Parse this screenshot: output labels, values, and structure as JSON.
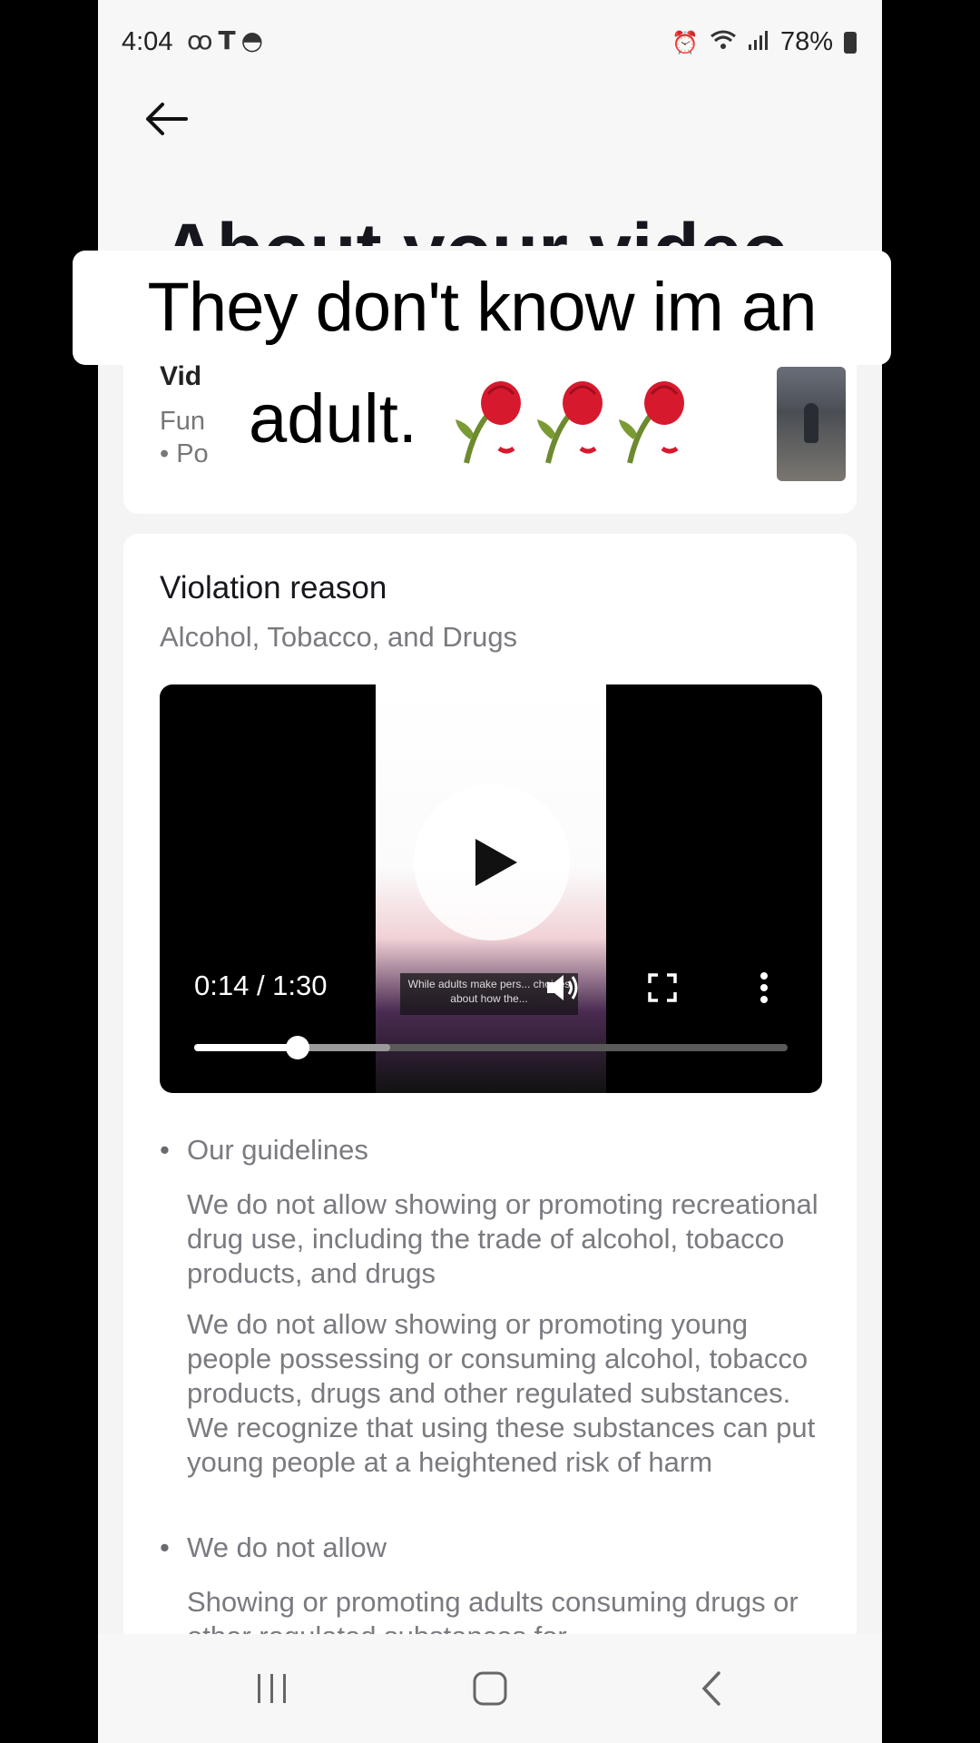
{
  "status_bar": {
    "time": "4:04",
    "battery": "78%",
    "left_icons": [
      "voicemail-icon",
      "t-mobile-icon",
      "incognito-icon"
    ],
    "right_icons": [
      "alarm-icon",
      "wifi-icon",
      "signal-icon",
      "battery-icon"
    ]
  },
  "header": {
    "title": "About your video"
  },
  "video_card": {
    "title_fragment": "Vid",
    "subtitle_fragment": "Fun",
    "bullet_fragment": "Po"
  },
  "violation": {
    "title": "Violation reason",
    "reason": "Alcohol, Tobacco, and Drugs"
  },
  "player": {
    "time_readout": "0:14 / 1:30",
    "caption": "While adults make pers... choices about how the...",
    "progress_fraction": 0.175,
    "buffer_fraction": 0.33
  },
  "guidelines": [
    {
      "heading": "Our guidelines",
      "paragraphs": [
        "We do not allow showing or promoting recreational drug use, including the trade of alcohol, tobacco products, and drugs",
        "We do not allow showing or promoting young people possessing or consuming alcohol, tobacco products, drugs and other regulated substances. We recognize that using these substances can put young people at a heightened risk of harm"
      ]
    },
    {
      "heading": "We do not allow",
      "paragraphs": [
        "Showing or promoting adults consuming drugs or other regulated substances for"
      ]
    }
  ],
  "overlay_caption": {
    "line1": "They don't know im an",
    "line2": "adult.",
    "emoji": "🥀🥀🥀"
  },
  "colors": {
    "page_bg": "#f4f4f5",
    "card_bg": "#ffffff",
    "title_text": "#16161e",
    "secondary_text": "#7a7a80",
    "rose_red": "#d7192e"
  }
}
